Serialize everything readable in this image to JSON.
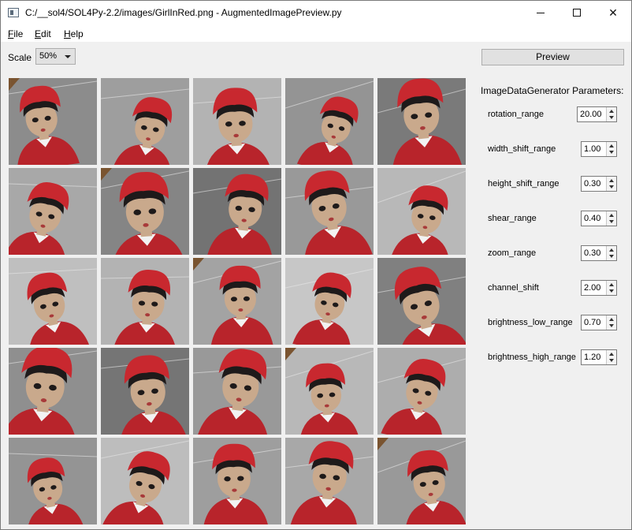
{
  "window": {
    "title": "C:/__sol4/SOL4Py-2.2/images/GirlInRed.png - AugmentedImagePreview.py",
    "minimize_label": "",
    "close_label": "✕"
  },
  "menu": [
    {
      "accel": "F",
      "rest": "ile"
    },
    {
      "accel": "E",
      "rest": "dit"
    },
    {
      "accel": "H",
      "rest": "elp"
    }
  ],
  "toolbar": {
    "scale_label": "Scale",
    "scale_value": "50%",
    "preview_label": "Preview"
  },
  "params": {
    "title": "ImageDataGenerator Parameters:",
    "items": [
      {
        "label": "rotation_range",
        "value": "20.00"
      },
      {
        "label": "width_shift_range",
        "value": "1.00"
      },
      {
        "label": "height_shift_range",
        "value": "0.30"
      },
      {
        "label": "shear_range",
        "value": "0.40"
      },
      {
        "label": "zoom_range",
        "value": "0.30"
      },
      {
        "label": "channel_shift",
        "value": "2.00"
      },
      {
        "label": "brightness_low_range",
        "value": "0.70"
      },
      {
        "label": "brightness_high_range",
        "value": "1.20"
      }
    ]
  },
  "colors": {
    "hat": "#c8282f",
    "coat": "#b8242b",
    "skin": "#c9a98c",
    "hair": "#1e1a1a",
    "background": "#8e8e8e",
    "accent_brown": "#7a5430"
  },
  "grid": {
    "rows": 5,
    "cols": 5,
    "thumbnail_subject": "girl-in-red-augmented-image"
  }
}
